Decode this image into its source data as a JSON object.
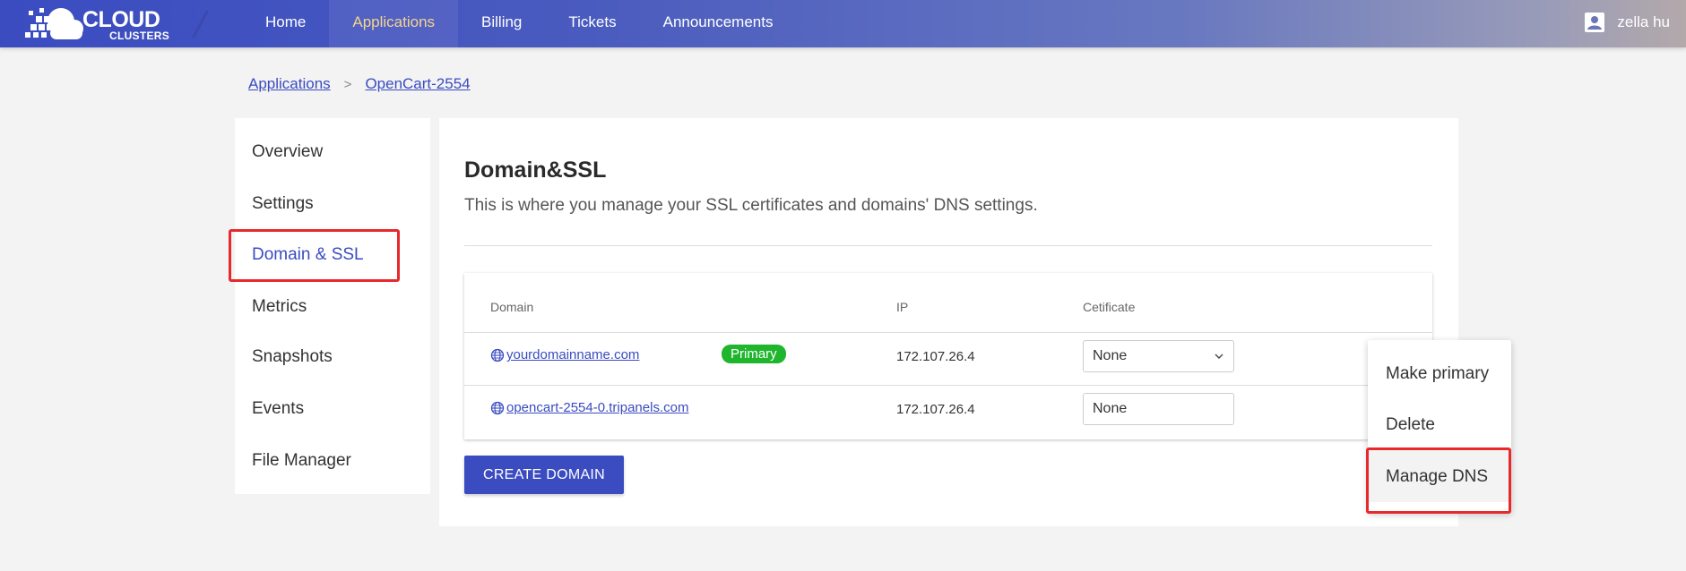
{
  "brand": {
    "line1": "CLOUD",
    "line2": "CLUSTERS"
  },
  "nav": {
    "items": [
      {
        "label": "Home"
      },
      {
        "label": "Applications"
      },
      {
        "label": "Billing"
      },
      {
        "label": "Tickets"
      },
      {
        "label": "Announcements"
      }
    ],
    "active_index": 1
  },
  "user": {
    "name": "zella hu"
  },
  "breadcrumb": {
    "root": "Applications",
    "separator": ">",
    "current": "OpenCart-2554"
  },
  "sidebar": {
    "items": [
      {
        "label": "Overview"
      },
      {
        "label": "Settings"
      },
      {
        "label": "Domain & SSL"
      },
      {
        "label": "Metrics"
      },
      {
        "label": "Snapshots"
      },
      {
        "label": "Events"
      },
      {
        "label": "File Manager"
      }
    ],
    "active_index": 2
  },
  "main": {
    "title": "Domain&SSL",
    "description": "This is where you manage your SSL certificates and domains' DNS settings.",
    "table": {
      "headers": {
        "domain": "Domain",
        "ip": "IP",
        "certificate": "Cetificate"
      },
      "rows": [
        {
          "domain": "yourdomainname.com",
          "badge": "Primary",
          "ip": "172.107.26.4",
          "certificate": "None"
        },
        {
          "domain": "opencart-2554-0.tripanels.com",
          "ip": "172.107.26.4",
          "certificate": "None"
        }
      ]
    },
    "create_button": "CREATE DOMAIN"
  },
  "menu": {
    "items": [
      {
        "label": "Make primary"
      },
      {
        "label": "Delete"
      },
      {
        "label": "Manage DNS"
      }
    ]
  },
  "colors": {
    "accent": "#3a4cc0",
    "nav_active": "#f5d58a",
    "badge_green": "#1fb52c",
    "highlight_red": "#e8282b"
  }
}
